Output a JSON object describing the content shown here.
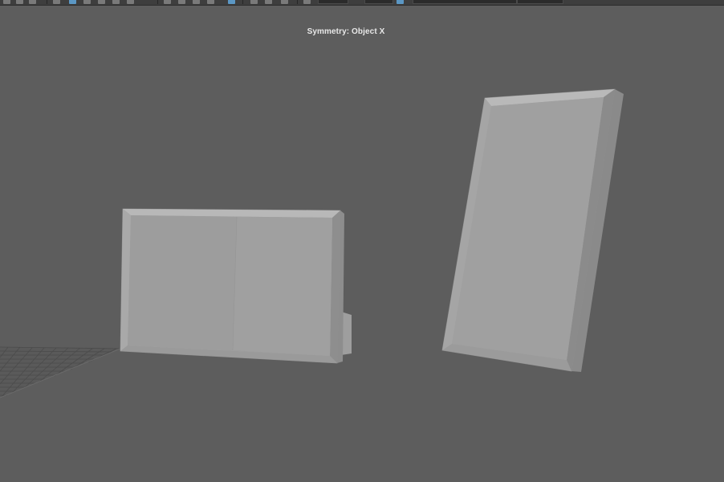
{
  "viewport": {
    "status_label": "Symmetry: Object X",
    "background_color": "#5d5d5d",
    "accent_color": "#5b97c4"
  },
  "toolbar": {
    "icons": [
      "select-tool-icon",
      "lasso-tool-icon",
      "paint-select-icon",
      "move-tool-icon",
      "rotate-tool-icon",
      "scale-tool-icon",
      "snap-grid-icon",
      "snap-curve-icon",
      "snap-point-icon",
      "render-icon",
      "ipr-render-icon",
      "render-settings-icon",
      "camera-icon",
      "display-settings-icon",
      "workspace-icon"
    ]
  },
  "scene": {
    "objects": [
      "frame-left",
      "frame-right",
      "ground-grid"
    ]
  }
}
